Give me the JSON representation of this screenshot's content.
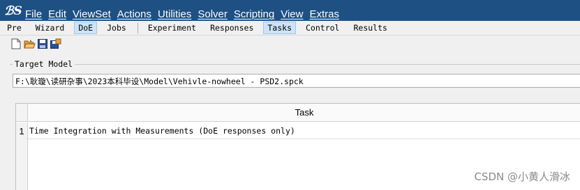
{
  "menubar": {
    "logo": "ℬS",
    "items": [
      "File",
      "Edit",
      "ViewSet",
      "Actions",
      "Utilities",
      "Solver",
      "Scripting",
      "View",
      "Extras"
    ]
  },
  "tabs": {
    "group1": [
      "Pre",
      "Wizard",
      "DoE",
      "Jobs"
    ],
    "group2": [
      "Experiment",
      "Responses",
      "Tasks",
      "Control",
      "Results"
    ],
    "active": [
      "DoE",
      "Tasks"
    ]
  },
  "toolbar": {
    "icons": [
      "new-file-icon",
      "open-folder-icon",
      "save-icon",
      "save-as-icon"
    ]
  },
  "target_model": {
    "label": "Target Model",
    "path": "F:\\耿璇\\读研杂事\\2023本科毕设\\Model\\Vehivle-nowheel - PSD2.spck"
  },
  "task_table": {
    "header": "Task",
    "rows": [
      {
        "num": "1",
        "task": "Time Integration with Measurements (DoE responses only)"
      }
    ]
  },
  "watermark": "CSDN @小黄人滑冰",
  "colors": {
    "menubar_bg": "#1e5083",
    "active_tab_bg": "#cde3f7"
  }
}
